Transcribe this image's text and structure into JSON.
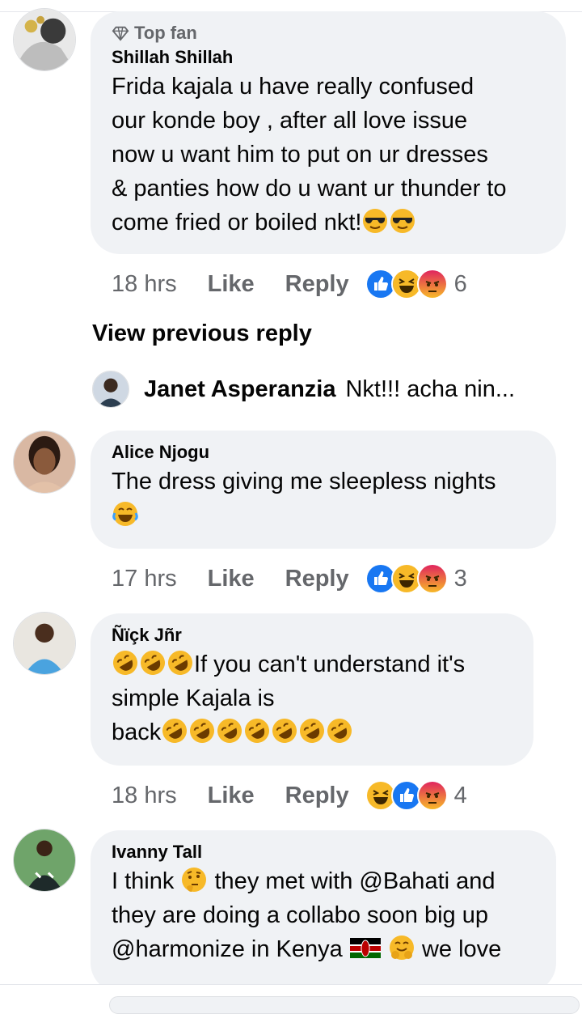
{
  "comments": [
    {
      "badge": "Top fan",
      "author": "Shillah Shillah",
      "text_lines": [
        "Frida kajala u have really confused",
        "our konde boy , after all love issue",
        "now u want him to put on ur dresses",
        "& panties how do u want ur thunder to",
        "come fried or boiled nkt!"
      ],
      "trailing_emojis": [
        "sunglasses",
        "sunglasses"
      ],
      "time": "18 hrs",
      "like_label": "Like",
      "reply_label": "Reply",
      "reactions": [
        "like",
        "haha",
        "angry"
      ],
      "reaction_count": "6"
    },
    {
      "author": "Alice Njogu",
      "text_lines": [
        "The dress giving me sleepless nights"
      ],
      "emoji_line": [
        "rofl-tears"
      ],
      "time": "17 hrs",
      "like_label": "Like",
      "reply_label": "Reply",
      "reactions": [
        "like",
        "haha",
        "angry"
      ],
      "reaction_count": "3"
    },
    {
      "author": "Ñïçk Jñr",
      "leading_emojis": [
        "rofl",
        "rofl",
        "rofl"
      ],
      "text_lines": [
        "If you can't understand it's",
        "simple Kajala is",
        "back"
      ],
      "trailing_emojis": [
        "rofl",
        "rofl",
        "rofl",
        "rofl",
        "rofl",
        "rofl",
        "rofl"
      ],
      "time": "18 hrs",
      "like_label": "Like",
      "reply_label": "Reply",
      "reactions": [
        "haha",
        "like",
        "angry"
      ],
      "reaction_count": "4"
    },
    {
      "author": "Ivanny Tall",
      "line1_a": "I think",
      "line1_b": "they met with @Bahati and",
      "line2": "they are doing a collabo soon big up",
      "line3_a": "@harmonize in Kenya",
      "line3_b": "we love"
    }
  ],
  "view_previous": "View previous reply",
  "reply_preview": {
    "author": "Janet Asperanzia",
    "text": "Nkt!!! acha nin..."
  },
  "colors": {
    "bubble": "#f0f2f5",
    "secondary_text": "#65676b",
    "like_blue": "#1877f2",
    "emoji_yellow": "#f7b928",
    "angry_orange": "#e9710f"
  }
}
